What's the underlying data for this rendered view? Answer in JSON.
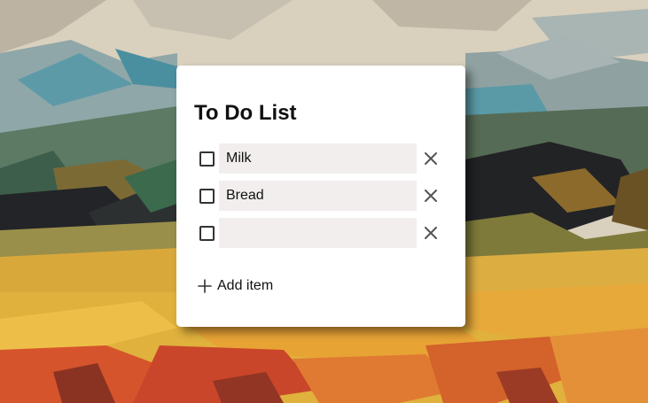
{
  "todo": {
    "title": "To Do List",
    "items": [
      {
        "value": "Milk",
        "checked": false
      },
      {
        "value": "Bread",
        "checked": false
      },
      {
        "value": "",
        "checked": false
      }
    ],
    "add_label": "Add item"
  },
  "colors": {
    "card_background": "#ffffff",
    "input_background": "#f2eeee",
    "text": "#111111",
    "icon": "#555555"
  },
  "icons": {
    "remove": "close-icon",
    "add": "plus-icon",
    "checkbox": "checkbox-unchecked"
  }
}
